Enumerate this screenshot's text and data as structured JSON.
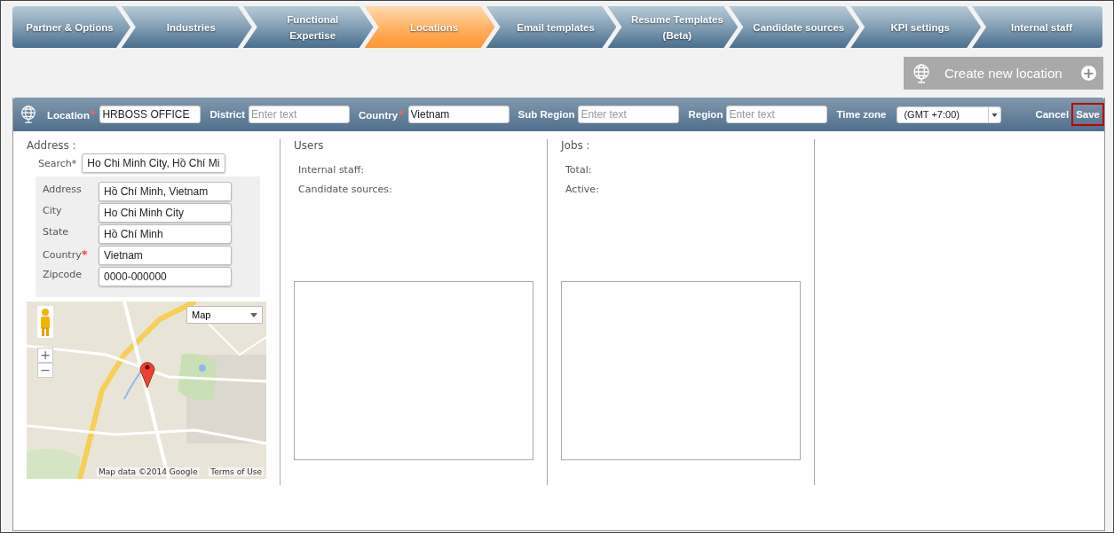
{
  "tabs": [
    {
      "label": "Partner & Options",
      "selected": false
    },
    {
      "label": "Industries",
      "selected": false
    },
    {
      "label": "Functional\nExpertise",
      "selected": false
    },
    {
      "label": "Locations",
      "selected": true
    },
    {
      "label": "Email templates",
      "selected": false
    },
    {
      "label": "Resume Templates\n(Beta)",
      "selected": false
    },
    {
      "label": "Candidate sources",
      "selected": false
    },
    {
      "label": "KPI settings",
      "selected": false
    },
    {
      "label": "Internal staff",
      "selected": false
    }
  ],
  "create_button": {
    "label": "Create new location",
    "plus": "+"
  },
  "location_bar": {
    "fields": [
      {
        "label": "Location",
        "mark": "*",
        "value": "HRBOSS OFFICE"
      },
      {
        "label": "District",
        "placeholder": "Enter text"
      },
      {
        "label": "Country",
        "mark": "*",
        "value": "Vietnam"
      },
      {
        "label": "Sub Region",
        "placeholder": "Enter text"
      },
      {
        "label": "Region",
        "placeholder": "Enter text"
      }
    ],
    "time_zone": {
      "label": "Time zone",
      "value": "(GMT +7:00)"
    },
    "cancel": "Cancel",
    "save": {
      "label": "Save",
      "focused": true
    }
  },
  "address": {
    "title": "Address :",
    "search": {
      "label": "Search*",
      "value": "Ho Chi Minh City, Hồ Chí Mi"
    },
    "fields": [
      {
        "label": "Address",
        "value": "Hồ Chí Minh, Vietnam"
      },
      {
        "label": "City",
        "value": "Ho Chi Minh City"
      },
      {
        "label": "State",
        "value": "Hồ Chí Minh"
      },
      {
        "label": "Country",
        "mark": "*",
        "value": "Vietnam"
      },
      {
        "label": "Zipcode",
        "value": "0000-000000"
      }
    ]
  },
  "map": {
    "type_select": "Map",
    "zoom_in": "+",
    "zoom_out": "−",
    "attribution": "Map data ©2014 Google",
    "terms": "Terms of Use"
  },
  "users": {
    "title": "Users",
    "lines": [
      "Internal staff:",
      "Candidate sources:"
    ]
  },
  "jobs": {
    "title": "Jobs :",
    "lines": [
      "Total:",
      "Active:"
    ]
  }
}
